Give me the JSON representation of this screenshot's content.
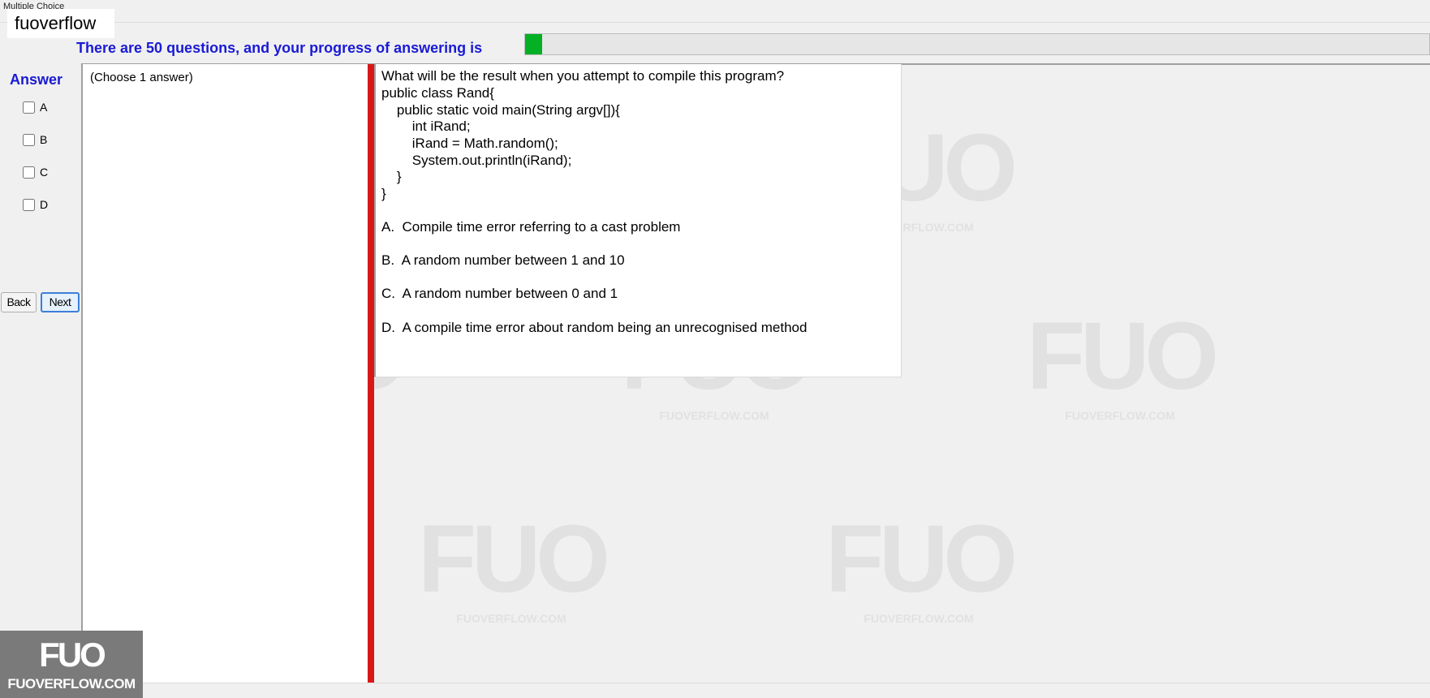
{
  "window": {
    "title": "Multiple Choice"
  },
  "brand": {
    "name": "fuoverflow"
  },
  "progress": {
    "text": "There are 50 questions, and your progress of answering is",
    "fraction": 0.019,
    "fill_color": "#06b025"
  },
  "answer_panel": {
    "title": "Answer",
    "options": [
      "A",
      "B",
      "C",
      "D"
    ],
    "checked": [
      false,
      false,
      false,
      false
    ]
  },
  "nav": {
    "back_label": "Back",
    "next_label": "Next"
  },
  "left_panel": {
    "hint": "(Choose 1 answer)"
  },
  "question": {
    "lines": [
      "What will be the result when you attempt to compile this program?",
      "public class Rand{",
      "    public static void main(String argv[]){",
      "        int iRand;",
      "        iRand = Math.random();",
      "        System.out.println(iRand);",
      "    }",
      "}"
    ],
    "answers": [
      "A.  Compile time error referring to a cast problem",
      "B.  A random number between 1 and 10",
      "C.  A random number between 0 and 1",
      "D.  A compile time error about random being an unrecognised method"
    ]
  },
  "watermark": {
    "mark": "FUO",
    "site": "FUOVERFLOW.COM"
  },
  "logo": {
    "mark": "FUO",
    "site": "FUOVERFLOW.COM"
  },
  "colors": {
    "accent_blue": "#1a1ad6",
    "divider_red": "#d81818"
  }
}
